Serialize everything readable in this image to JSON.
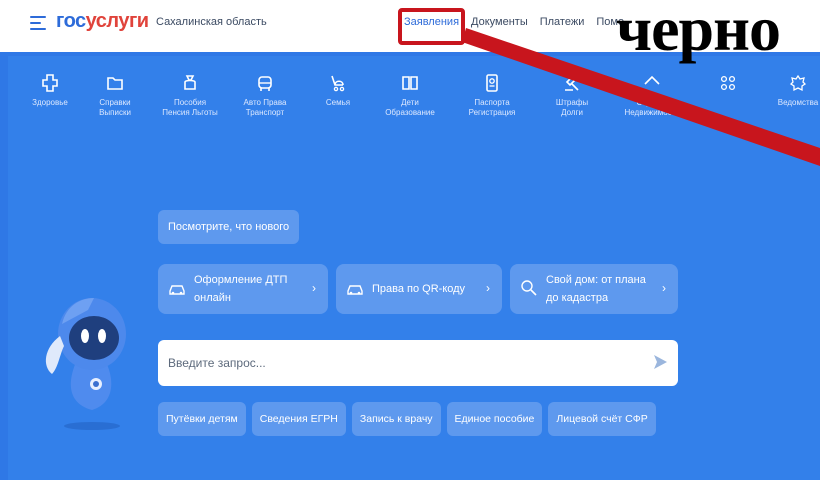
{
  "header": {
    "logo_part1": "гос",
    "logo_part2": "услуги",
    "region": "Сахалинская область",
    "nav": [
      "Заявления",
      "Документы",
      "Платежи",
      "Помо"
    ]
  },
  "annotation": {
    "text": "черно"
  },
  "categories": [
    {
      "icon": "health-icon",
      "label": "Здоровье"
    },
    {
      "icon": "folder-icon",
      "label": "Справки\nВыписки"
    },
    {
      "icon": "bag-icon",
      "label": "Пособия\nПенсия Льготы"
    },
    {
      "icon": "car-icon",
      "label": "Авто Права\nТранспорт"
    },
    {
      "icon": "stroller-icon",
      "label": "Семья"
    },
    {
      "icon": "book-icon",
      "label": "Дети\nОбразование"
    },
    {
      "icon": "passport-icon",
      "label": "Паспорта\nРегистрация"
    },
    {
      "icon": "gavel-icon",
      "label": "Штрафы\nДолги"
    },
    {
      "icon": "house-icon",
      "label": "Стройка\nНедвижимость"
    },
    {
      "icon": "grid-icon",
      "label": ""
    },
    {
      "icon": "emblem-icon",
      "label": "Ведомства"
    }
  ],
  "whats_new": "Посмотрите, что нового",
  "cards": [
    {
      "icon": "car-icon",
      "label": "Оформление ДТП\nонлайн",
      "chevron": "›"
    },
    {
      "icon": "car-icon",
      "label": "Права по QR-коду",
      "chevron": "›"
    },
    {
      "icon": "search-icon",
      "label": "Свой дом: от плана\nдо кадастра",
      "chevron": "›"
    }
  ],
  "search": {
    "placeholder": "Введите запрос..."
  },
  "chips": [
    "Путёвки детям",
    "Сведения ЕГРН",
    "Запись к врачу",
    "Единое пособие",
    "Лицевой счёт СФР"
  ],
  "colors": {
    "brand_blue": "#2f78e6",
    "accent_red": "#e0433b",
    "annotation_red": "#c8151d"
  }
}
